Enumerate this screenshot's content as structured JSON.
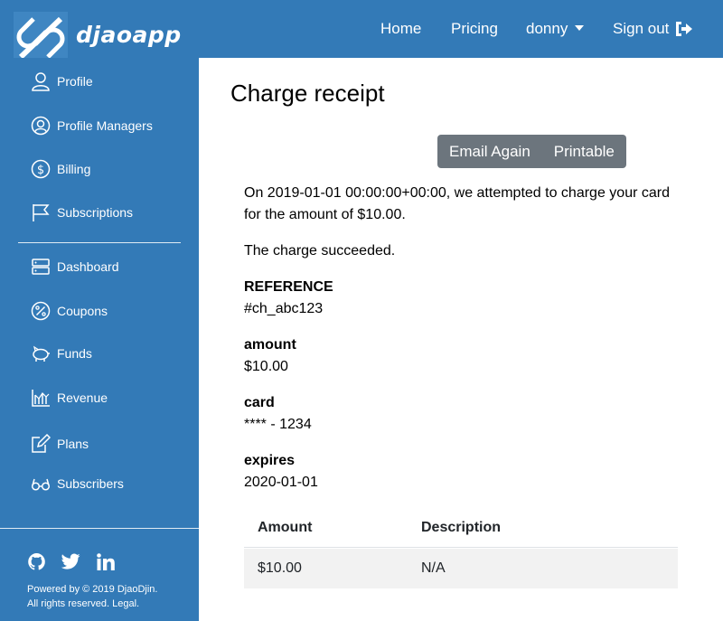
{
  "header": {
    "brand": "djaoapp",
    "nav": {
      "home": "Home",
      "pricing": "Pricing",
      "user": "donny",
      "signout": "Sign out"
    }
  },
  "sidebar": {
    "items": [
      {
        "label": "Profile",
        "icon": "user-icon"
      },
      {
        "label": "Profile Managers",
        "icon": "user-circle-icon"
      },
      {
        "label": "Billing",
        "icon": "dollar-icon"
      },
      {
        "label": "Subscriptions",
        "icon": "flag-icon"
      },
      {
        "label": "Dashboard",
        "icon": "server-icon"
      },
      {
        "label": "Coupons",
        "icon": "percent-icon"
      },
      {
        "label": "Funds",
        "icon": "piggy-bank-icon"
      },
      {
        "label": "Revenue",
        "icon": "chart-icon"
      },
      {
        "label": "Plans",
        "icon": "edit-icon"
      },
      {
        "label": "Subscribers",
        "icon": "glasses-icon"
      }
    ],
    "social": [
      "github-icon",
      "twitter-icon",
      "linkedin-icon"
    ],
    "footer": {
      "line1": "Powered by © 2019 DjaoDjin.",
      "line2": "All rights reserved. Legal."
    }
  },
  "main": {
    "title": "Charge receipt",
    "buttons": {
      "email_again": "Email Again",
      "printable": "Printable"
    },
    "intro_line1": "On 2019-01-01 00:00:00+00:00, we attempted to charge your card",
    "intro_line2": "for the amount of $10.00.",
    "status": "The charge succeeded.",
    "fields": [
      {
        "label": "REFERENCE",
        "value": "#ch_abc123"
      },
      {
        "label": "amount",
        "value": "$10.00"
      },
      {
        "label": "card",
        "value": "**** - 1234"
      },
      {
        "label": "expires",
        "value": "2020-01-01"
      }
    ],
    "table": {
      "headers": [
        "Amount",
        "Description"
      ],
      "rows": [
        [
          "$10.00",
          "N/A"
        ]
      ]
    }
  },
  "colors": {
    "brand": "#337ab7",
    "button": "#6c757d",
    "row_stripe": "#f2f2f2"
  }
}
